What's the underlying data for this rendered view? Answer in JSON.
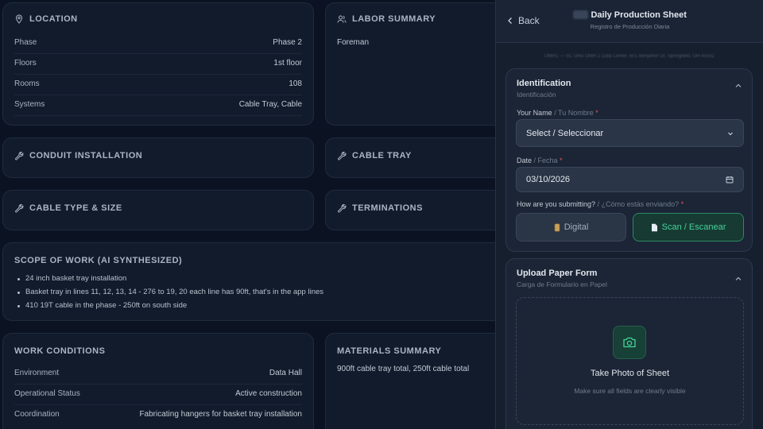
{
  "location": {
    "title": "LOCATION",
    "rows": [
      {
        "k": "Phase",
        "v": "Phase 2"
      },
      {
        "k": "Floors",
        "v": "1st floor"
      },
      {
        "k": "Rooms",
        "v": "108"
      },
      {
        "k": "Systems",
        "v": "Cable Tray, Cable"
      }
    ]
  },
  "labor": {
    "title": "LABOR SUMMARY",
    "foreman_label": "Foreman"
  },
  "conduit": {
    "title": "CONDUIT INSTALLATION"
  },
  "cable_tray": {
    "title": "CABLE TRAY"
  },
  "cable_type": {
    "title": "CABLE TYPE & SIZE"
  },
  "terminations": {
    "title": "TERMINATIONS"
  },
  "scope": {
    "title": "SCOPE OF WORK (AI SYNTHESIZED)",
    "items": [
      "24 inch basket tray installation",
      "Basket tray in lines 11, 12, 13, 14 - 276 to 19, 20 each line has 90ft, that's in the app lines",
      "410 19T cable in the phase - 250ft on south side"
    ]
  },
  "work_conditions": {
    "title": "WORK CONDITIONS",
    "rows": [
      {
        "k": "Environment",
        "v": "Data Hall"
      },
      {
        "k": "Operational Status",
        "v": "Active construction"
      },
      {
        "k": "Coordination",
        "v": "Fabricating hangers for basket tray installation"
      }
    ]
  },
  "materials": {
    "title": "MATERIALS SUMMARY",
    "text": "900ft cable tray total, 250ft cable total"
  },
  "panel": {
    "back": "Back",
    "title_prefix": "EIC",
    "title": "Daily Production Sheet",
    "subtitle": "Registro de Producción Diaria",
    "address": "OMH1 — SC Ohio OMH 1 Data Center, 601 Benjamin Dr, Springfield, OH 45502",
    "identification": {
      "title": "Identification",
      "subtitle": "Identificación",
      "name_label": "Your Name",
      "name_label_es": "/ Tu Nombre",
      "required": "*",
      "name_value": "Select / Seleccionar",
      "date_label": "Date",
      "date_label_es": "/ Fecha",
      "date_value": "03/10/2026",
      "submit_label": "How are you submitting?",
      "submit_label_es": "/ ¿Cómo estás enviando?",
      "digital": "Digital",
      "scan": "Scan / Escanear"
    },
    "upload": {
      "title": "Upload Paper Form",
      "subtitle": "Carga de Formulario en Papel",
      "take_photo": "Take Photo of Sheet",
      "hint": "Make sure all fields are clearly visible"
    }
  },
  "colors": {
    "accent_green": "#45d39a",
    "required_red": "#e25555",
    "background": "#0b1322"
  }
}
